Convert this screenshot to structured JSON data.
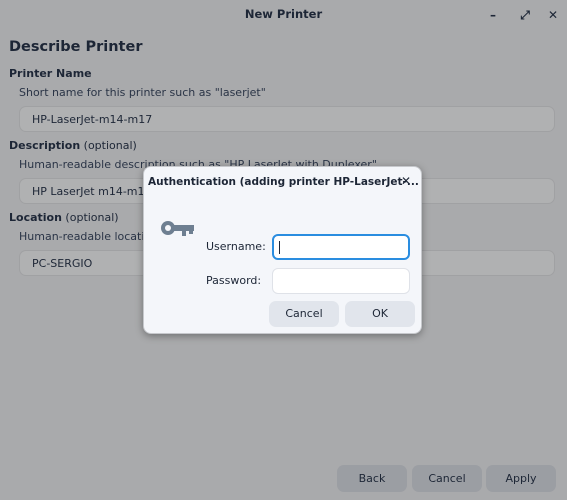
{
  "window": {
    "title": "New Printer",
    "minimize_icon": "minimize-icon",
    "maximize_icon": "maximize-icon",
    "close_icon": "close-icon",
    "minimize_glyph": "–",
    "maximize_glyph": "⤢",
    "close_glyph": "✕"
  },
  "page": {
    "heading": "Describe Printer",
    "printer_name": {
      "label": "Printer Name",
      "hint": "Short name for this printer such as \"laserjet\"",
      "value": "HP-LaserJet-m14-m17"
    },
    "description": {
      "label": "Description",
      "optional": " (optional)",
      "hint": "Human-readable description such as \"HP LaserJet with Duplexer\"",
      "value": "HP LaserJet m14-m17"
    },
    "location": {
      "label": "Location",
      "optional": " (optional)",
      "hint": "Human-readable location such as \"Lab 1\"",
      "value": "PC-SERGIO"
    }
  },
  "footer": {
    "back": "Back",
    "cancel": "Cancel",
    "apply": "Apply"
  },
  "auth_dialog": {
    "title": "Authentication (adding printer HP-LaserJet-...",
    "close_glyph": "✕",
    "icon": "key-icon",
    "username_label": "Username:",
    "username_value": "",
    "password_label": "Password:",
    "password_value": "",
    "cancel": "Cancel",
    "ok": "OK",
    "focus_color": "#2a8de0"
  }
}
